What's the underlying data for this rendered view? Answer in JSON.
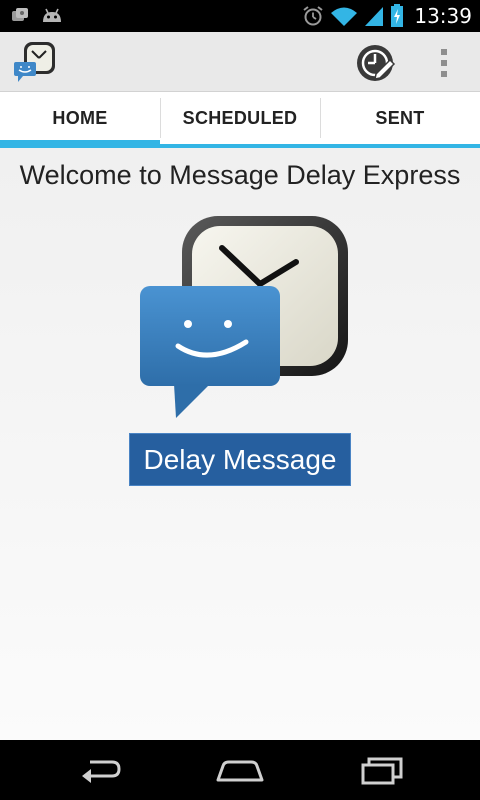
{
  "status_bar": {
    "time": "13:39",
    "icons": [
      "photo-notification-icon",
      "android-notification-icon",
      "alarm-icon",
      "wifi-icon",
      "signal-icon",
      "battery-charging-icon"
    ]
  },
  "action_bar": {
    "app_icon": "message-clock-icon",
    "actions": [
      "schedule-icon",
      "overflow-menu-icon"
    ]
  },
  "tabs": [
    {
      "label": "HOME",
      "selected": true
    },
    {
      "label": "SCHEDULED",
      "selected": false
    },
    {
      "label": "SENT",
      "selected": false
    }
  ],
  "main": {
    "welcome_text": "Welcome to Message Delay Express",
    "hero_icon": "message-clock-icon",
    "delay_button_label": "Delay Message"
  },
  "nav_bar": {
    "buttons": [
      "back-icon",
      "home-icon",
      "recent-apps-icon"
    ]
  },
  "colors": {
    "accent": "#33b5e5",
    "button": "#265f9f",
    "bubble": "#3f88c8"
  }
}
